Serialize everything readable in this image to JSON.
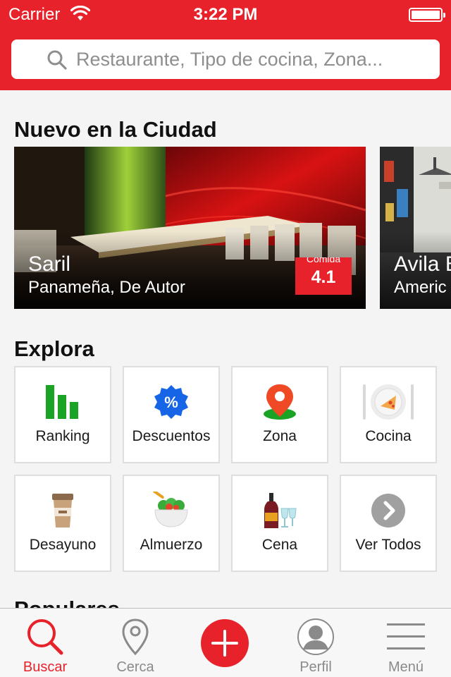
{
  "status_bar": {
    "carrier": "Carrier",
    "time": "3:22 PM"
  },
  "search": {
    "placeholder": "Restaurante, Tipo de cocina, Zona..."
  },
  "new_in_city": {
    "title": "Nuevo en la Ciudad",
    "cards": [
      {
        "name": "Saril",
        "cuisine": "Panameña, De Autor",
        "rating_label": "Comida",
        "rating": "4.1"
      },
      {
        "name": "Avila B",
        "cuisine": "Americ"
      }
    ]
  },
  "explore": {
    "title": "Explora",
    "tiles": [
      {
        "label": "Ranking",
        "icon": "ranking-bars-icon"
      },
      {
        "label": "Descuentos",
        "icon": "discount-badge-icon"
      },
      {
        "label": "Zona",
        "icon": "location-pin-icon"
      },
      {
        "label": "Cocina",
        "icon": "plate-cutlery-icon"
      },
      {
        "label": "Desayuno",
        "icon": "coffee-cup-icon"
      },
      {
        "label": "Almuerzo",
        "icon": "salad-bowl-icon"
      },
      {
        "label": "Cena",
        "icon": "wine-glasses-icon"
      },
      {
        "label": "Ver Todos",
        "icon": "chevron-right-icon"
      }
    ]
  },
  "popular": {
    "title": "Populares"
  },
  "tab_bar": {
    "items": [
      {
        "label": "Buscar",
        "icon": "search-icon",
        "active": true
      },
      {
        "label": "Cerca",
        "icon": "location-pin-outline-icon",
        "active": false
      },
      {
        "label": "",
        "icon": "plus-icon",
        "active": false
      },
      {
        "label": "Perfil",
        "icon": "profile-icon",
        "active": false
      },
      {
        "label": "Menú",
        "icon": "hamburger-menu-icon",
        "active": false
      }
    ]
  },
  "colors": {
    "accent": "#e8222a",
    "tile_border": "#dedede",
    "background": "#f4f4f4"
  }
}
